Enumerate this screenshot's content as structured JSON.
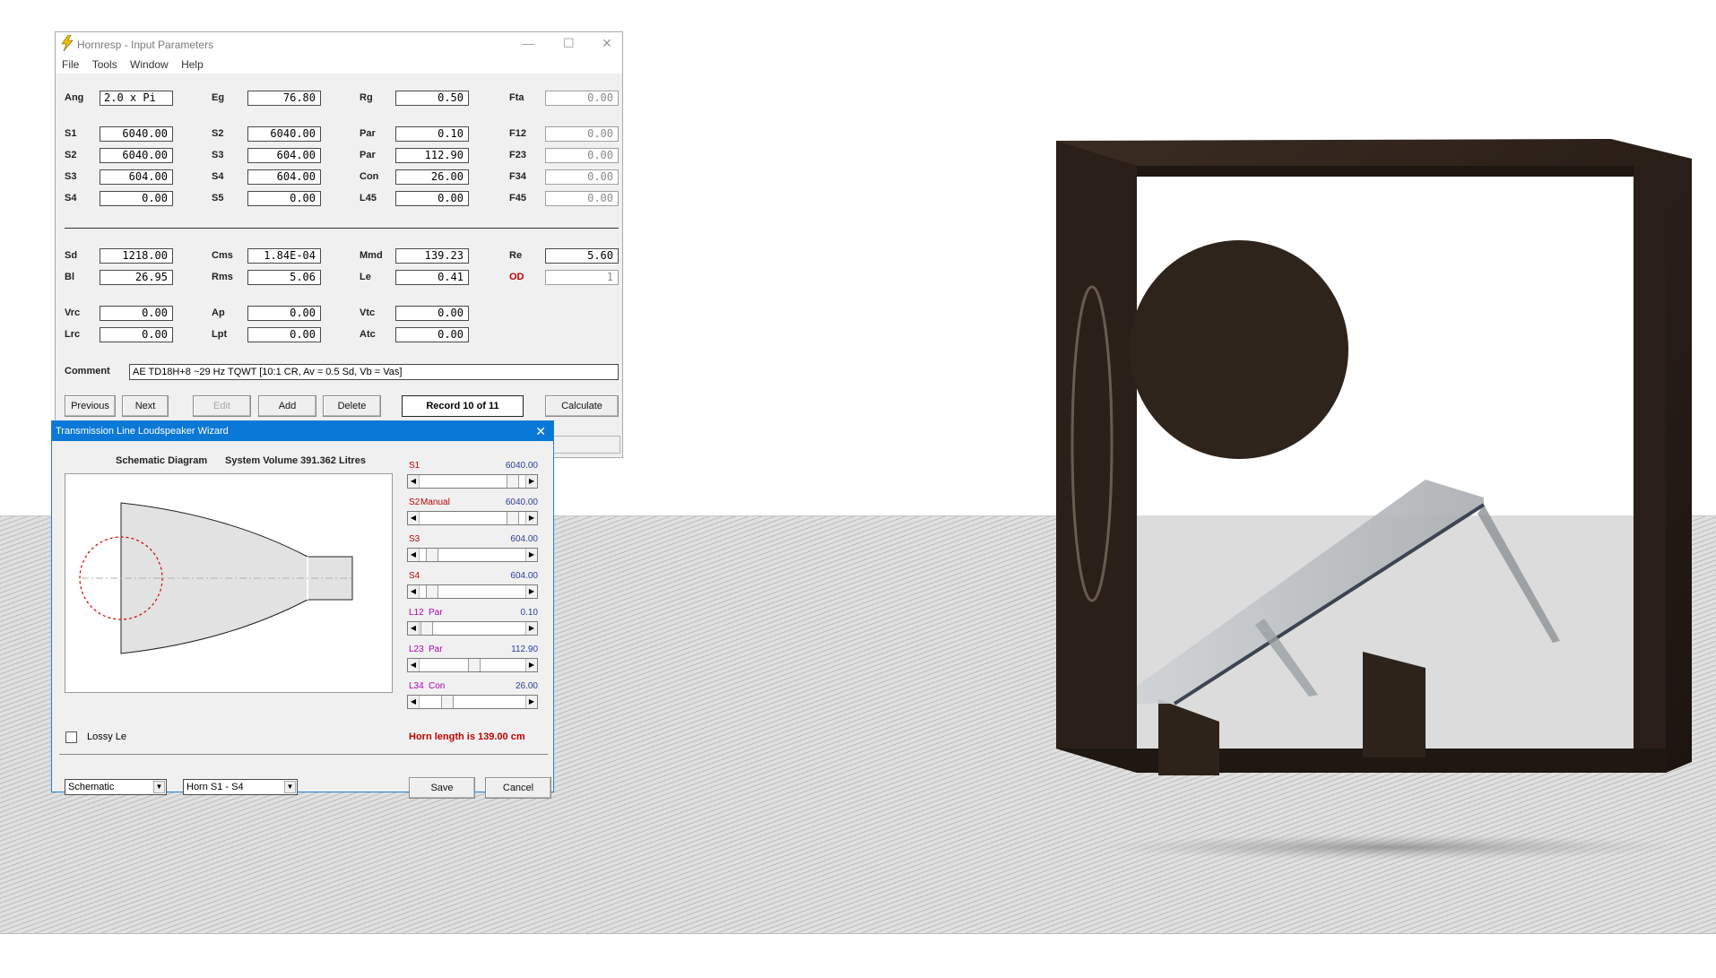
{
  "hornresp": {
    "title": "Hornresp - Input Parameters",
    "menu": [
      "File",
      "Tools",
      "Window",
      "Help"
    ],
    "rows1": {
      "ang": {
        "label": "Ang",
        "value": "2.0 x Pi"
      },
      "eg": {
        "label": "Eg",
        "value": "76.80"
      },
      "rg": {
        "label": "Rg",
        "value": "0.50"
      },
      "fta": {
        "label": "Fta",
        "value": "0.00"
      }
    },
    "col1": [
      {
        "label": "S1",
        "value": "6040.00"
      },
      {
        "label": "S2",
        "value": "6040.00"
      },
      {
        "label": "S3",
        "value": "604.00"
      },
      {
        "label": "S4",
        "value": "0.00"
      }
    ],
    "col2": [
      {
        "label": "S2",
        "value": "6040.00"
      },
      {
        "label": "S3",
        "value": "604.00"
      },
      {
        "label": "S4",
        "value": "604.00"
      },
      {
        "label": "S5",
        "value": "0.00"
      }
    ],
    "col3": [
      {
        "label": "Par",
        "value": "0.10"
      },
      {
        "label": "Par",
        "value": "112.90"
      },
      {
        "label": "Con",
        "value": "26.00"
      },
      {
        "label": "L45",
        "value": "0.00"
      }
    ],
    "col4": [
      {
        "label": "F12",
        "value": "0.00"
      },
      {
        "label": "F23",
        "value": "0.00"
      },
      {
        "label": "F34",
        "value": "0.00"
      },
      {
        "label": "F45",
        "value": "0.00"
      }
    ],
    "driver": {
      "sd": {
        "label": "Sd",
        "value": "1218.00"
      },
      "bl": {
        "label": "Bl",
        "value": "26.95"
      },
      "cms": {
        "label": "Cms",
        "value": "1.84E-04"
      },
      "rms": {
        "label": "Rms",
        "value": "5.06"
      },
      "mmd": {
        "label": "Mmd",
        "value": "139.23"
      },
      "le": {
        "label": "Le",
        "value": "0.41"
      },
      "re": {
        "label": "Re",
        "value": "5.60"
      },
      "od": {
        "label": "OD",
        "value": "1"
      }
    },
    "chamber": {
      "vrc": {
        "label": "Vrc",
        "value": "0.00"
      },
      "lrc": {
        "label": "Lrc",
        "value": "0.00"
      },
      "ap": {
        "label": "Ap",
        "value": "0.00"
      },
      "lpt": {
        "label": "Lpt",
        "value": "0.00"
      },
      "vtc": {
        "label": "Vtc",
        "value": "0.00"
      },
      "atc": {
        "label": "Atc",
        "value": "0.00"
      }
    },
    "comment_label": "Comment",
    "comment": "AE TD18H+8 ~29 Hz TQWT [10:1 CR, Av = 0.5 Sd, Vb = Vas]",
    "buttons": {
      "previous": "Previous",
      "next": "Next",
      "edit": "Edit",
      "add": "Add",
      "delete": "Delete",
      "calculate": "Calculate"
    },
    "record": "Record 10 of 11"
  },
  "wizard": {
    "title": "Transmission Line Loudspeaker Wizard",
    "schematic_title": "Schematic Diagram",
    "system_volume": "System Volume 391.362 Litres",
    "sliders": [
      {
        "label": "S1",
        "tag": "",
        "value": "6040.00",
        "label_color": "#c00000",
        "position": 0.92
      },
      {
        "label": "S2",
        "tag": "Manual",
        "value": "6040.00",
        "label_color": "#c00000",
        "position": 0.92
      },
      {
        "label": "S3",
        "tag": "",
        "value": "604.00",
        "label_color": "#c00000",
        "position": 0.08
      },
      {
        "label": "S4",
        "tag": "",
        "value": "604.00",
        "label_color": "#c00000",
        "position": 0.08
      },
      {
        "label": "L12",
        "tag": "Par",
        "value": "0.10",
        "label_color": "#b000b0",
        "position": 0.02
      },
      {
        "label": "L23",
        "tag": "Par",
        "value": "112.90",
        "label_color": "#b000b0",
        "position": 0.52
      },
      {
        "label": "L34",
        "tag": "Con",
        "value": "26.00",
        "label_color": "#b000b0",
        "position": 0.24
      }
    ],
    "lossy_le": "Lossy Le",
    "horn_length": "Horn length is 139.00 cm",
    "combo1": "Schematic",
    "combo2": "Horn S1 - S4",
    "save": "Save",
    "cancel": "Cancel"
  }
}
